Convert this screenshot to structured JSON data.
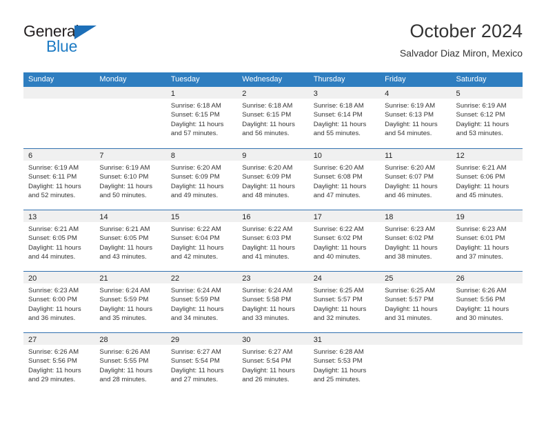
{
  "brand": {
    "name_top": "General",
    "name_bottom": "Blue",
    "accent_color": "#1d7bc4",
    "triangle_color": "#1d6fb8"
  },
  "header": {
    "title": "October 2024",
    "subtitle": "Salvador Diaz Miron, Mexico"
  },
  "theme": {
    "header_blue": "#2f7ec0",
    "row_divider_blue": "#2f6fae",
    "daynum_strip_gray": "#f0f0f0",
    "text_color": "#333333"
  },
  "calendar": {
    "weekday_headers": [
      "Sunday",
      "Monday",
      "Tuesday",
      "Wednesday",
      "Thursday",
      "Friday",
      "Saturday"
    ],
    "weeks": [
      [
        {
          "day": "",
          "lines": []
        },
        {
          "day": "",
          "lines": []
        },
        {
          "day": "1",
          "lines": [
            "Sunrise: 6:18 AM",
            "Sunset: 6:15 PM",
            "Daylight: 11 hours",
            "and 57 minutes."
          ]
        },
        {
          "day": "2",
          "lines": [
            "Sunrise: 6:18 AM",
            "Sunset: 6:15 PM",
            "Daylight: 11 hours",
            "and 56 minutes."
          ]
        },
        {
          "day": "3",
          "lines": [
            "Sunrise: 6:18 AM",
            "Sunset: 6:14 PM",
            "Daylight: 11 hours",
            "and 55 minutes."
          ]
        },
        {
          "day": "4",
          "lines": [
            "Sunrise: 6:19 AM",
            "Sunset: 6:13 PM",
            "Daylight: 11 hours",
            "and 54 minutes."
          ]
        },
        {
          "day": "5",
          "lines": [
            "Sunrise: 6:19 AM",
            "Sunset: 6:12 PM",
            "Daylight: 11 hours",
            "and 53 minutes."
          ]
        }
      ],
      [
        {
          "day": "6",
          "lines": [
            "Sunrise: 6:19 AM",
            "Sunset: 6:11 PM",
            "Daylight: 11 hours",
            "and 52 minutes."
          ]
        },
        {
          "day": "7",
          "lines": [
            "Sunrise: 6:19 AM",
            "Sunset: 6:10 PM",
            "Daylight: 11 hours",
            "and 50 minutes."
          ]
        },
        {
          "day": "8",
          "lines": [
            "Sunrise: 6:20 AM",
            "Sunset: 6:09 PM",
            "Daylight: 11 hours",
            "and 49 minutes."
          ]
        },
        {
          "day": "9",
          "lines": [
            "Sunrise: 6:20 AM",
            "Sunset: 6:09 PM",
            "Daylight: 11 hours",
            "and 48 minutes."
          ]
        },
        {
          "day": "10",
          "lines": [
            "Sunrise: 6:20 AM",
            "Sunset: 6:08 PM",
            "Daylight: 11 hours",
            "and 47 minutes."
          ]
        },
        {
          "day": "11",
          "lines": [
            "Sunrise: 6:20 AM",
            "Sunset: 6:07 PM",
            "Daylight: 11 hours",
            "and 46 minutes."
          ]
        },
        {
          "day": "12",
          "lines": [
            "Sunrise: 6:21 AM",
            "Sunset: 6:06 PM",
            "Daylight: 11 hours",
            "and 45 minutes."
          ]
        }
      ],
      [
        {
          "day": "13",
          "lines": [
            "Sunrise: 6:21 AM",
            "Sunset: 6:05 PM",
            "Daylight: 11 hours",
            "and 44 minutes."
          ]
        },
        {
          "day": "14",
          "lines": [
            "Sunrise: 6:21 AM",
            "Sunset: 6:05 PM",
            "Daylight: 11 hours",
            "and 43 minutes."
          ]
        },
        {
          "day": "15",
          "lines": [
            "Sunrise: 6:22 AM",
            "Sunset: 6:04 PM",
            "Daylight: 11 hours",
            "and 42 minutes."
          ]
        },
        {
          "day": "16",
          "lines": [
            "Sunrise: 6:22 AM",
            "Sunset: 6:03 PM",
            "Daylight: 11 hours",
            "and 41 minutes."
          ]
        },
        {
          "day": "17",
          "lines": [
            "Sunrise: 6:22 AM",
            "Sunset: 6:02 PM",
            "Daylight: 11 hours",
            "and 40 minutes."
          ]
        },
        {
          "day": "18",
          "lines": [
            "Sunrise: 6:23 AM",
            "Sunset: 6:02 PM",
            "Daylight: 11 hours",
            "and 38 minutes."
          ]
        },
        {
          "day": "19",
          "lines": [
            "Sunrise: 6:23 AM",
            "Sunset: 6:01 PM",
            "Daylight: 11 hours",
            "and 37 minutes."
          ]
        }
      ],
      [
        {
          "day": "20",
          "lines": [
            "Sunrise: 6:23 AM",
            "Sunset: 6:00 PM",
            "Daylight: 11 hours",
            "and 36 minutes."
          ]
        },
        {
          "day": "21",
          "lines": [
            "Sunrise: 6:24 AM",
            "Sunset: 5:59 PM",
            "Daylight: 11 hours",
            "and 35 minutes."
          ]
        },
        {
          "day": "22",
          "lines": [
            "Sunrise: 6:24 AM",
            "Sunset: 5:59 PM",
            "Daylight: 11 hours",
            "and 34 minutes."
          ]
        },
        {
          "day": "23",
          "lines": [
            "Sunrise: 6:24 AM",
            "Sunset: 5:58 PM",
            "Daylight: 11 hours",
            "and 33 minutes."
          ]
        },
        {
          "day": "24",
          "lines": [
            "Sunrise: 6:25 AM",
            "Sunset: 5:57 PM",
            "Daylight: 11 hours",
            "and 32 minutes."
          ]
        },
        {
          "day": "25",
          "lines": [
            "Sunrise: 6:25 AM",
            "Sunset: 5:57 PM",
            "Daylight: 11 hours",
            "and 31 minutes."
          ]
        },
        {
          "day": "26",
          "lines": [
            "Sunrise: 6:26 AM",
            "Sunset: 5:56 PM",
            "Daylight: 11 hours",
            "and 30 minutes."
          ]
        }
      ],
      [
        {
          "day": "27",
          "lines": [
            "Sunrise: 6:26 AM",
            "Sunset: 5:56 PM",
            "Daylight: 11 hours",
            "and 29 minutes."
          ]
        },
        {
          "day": "28",
          "lines": [
            "Sunrise: 6:26 AM",
            "Sunset: 5:55 PM",
            "Daylight: 11 hours",
            "and 28 minutes."
          ]
        },
        {
          "day": "29",
          "lines": [
            "Sunrise: 6:27 AM",
            "Sunset: 5:54 PM",
            "Daylight: 11 hours",
            "and 27 minutes."
          ]
        },
        {
          "day": "30",
          "lines": [
            "Sunrise: 6:27 AM",
            "Sunset: 5:54 PM",
            "Daylight: 11 hours",
            "and 26 minutes."
          ]
        },
        {
          "day": "31",
          "lines": [
            "Sunrise: 6:28 AM",
            "Sunset: 5:53 PM",
            "Daylight: 11 hours",
            "and 25 minutes."
          ]
        },
        {
          "day": "",
          "lines": []
        },
        {
          "day": "",
          "lines": []
        }
      ]
    ]
  }
}
